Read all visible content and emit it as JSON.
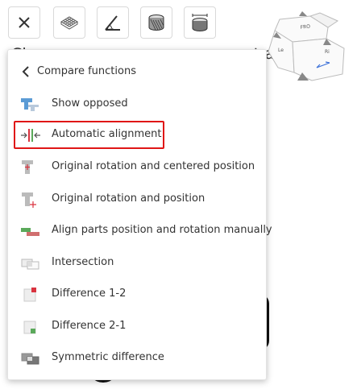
{
  "background": {
    "heading_left": "Ch",
    "heading_right": "rt as base"
  },
  "toolbar": {
    "buttons": [
      {
        "name": "close-icon"
      },
      {
        "name": "mesh-icon"
      },
      {
        "name": "measure-angle-icon"
      },
      {
        "name": "section-icon"
      },
      {
        "name": "dimension-icon"
      }
    ]
  },
  "nav_cube": {
    "face_top": "FRO",
    "face_front": "Le",
    "face_right": "Ri"
  },
  "menu": {
    "title": "Compare functions",
    "items": [
      {
        "label": "Show opposed",
        "icon": "show-opposed-icon"
      },
      {
        "label": "Automatic alignment",
        "icon": "automatic-alignment-icon",
        "highlighted": true
      },
      {
        "label": "Original rotation and centered position",
        "icon": "original-centered-icon"
      },
      {
        "label": "Original rotation and position",
        "icon": "original-position-icon"
      },
      {
        "label": "Align parts position and rotation manually",
        "icon": "manual-align-icon"
      },
      {
        "label": "Intersection",
        "icon": "intersection-icon"
      },
      {
        "label": "Difference 1-2",
        "icon": "difference-1-2-icon"
      },
      {
        "label": "Difference 2-1",
        "icon": "difference-2-1-icon"
      },
      {
        "label": "Symmetric difference",
        "icon": "symmetric-difference-icon"
      }
    ]
  },
  "colors": {
    "highlight": "#e01616",
    "blue": "#5b9bd5",
    "green": "#5aa95a",
    "red": "#d9333f"
  }
}
